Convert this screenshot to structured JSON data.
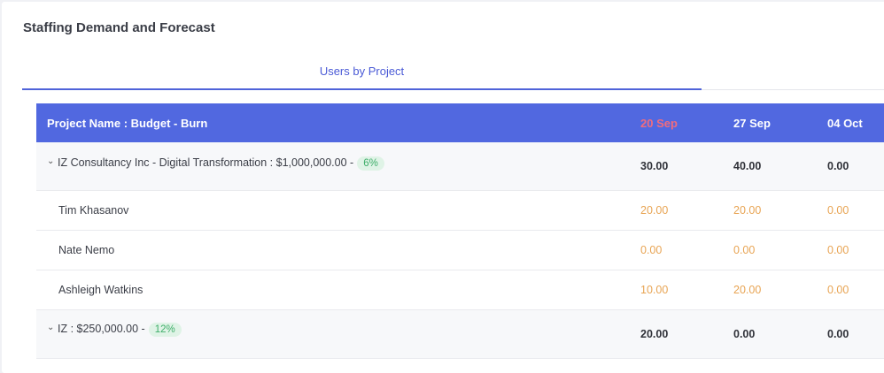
{
  "card": {
    "title": "Staffing Demand and Forecast"
  },
  "tabs": [
    {
      "label": "Users by Project"
    }
  ],
  "table": {
    "header": {
      "name": "Project Name : Budget - Burn",
      "weeks": [
        "20 Sep",
        "27 Sep",
        "04 Oct"
      ],
      "current_week_color": "#f06c7e"
    },
    "groups": [
      {
        "label": "IZ Consultancy Inc - Digital Transformation : $1,000,000.00 -",
        "burn": "6%",
        "totals": [
          "30.00",
          "40.00",
          "0.00"
        ],
        "users": [
          {
            "name": "Tim Khasanov",
            "values": [
              "20.00",
              "20.00",
              "0.00"
            ]
          },
          {
            "name": "Nate Nemo",
            "values": [
              "0.00",
              "0.00",
              "0.00"
            ]
          },
          {
            "name": "Ashleigh Watkins",
            "values": [
              "10.00",
              "20.00",
              "0.00"
            ]
          }
        ]
      },
      {
        "label": "IZ : $250,000.00 -",
        "burn": "12%",
        "totals": [
          "20.00",
          "0.00",
          "0.00"
        ]
      }
    ]
  },
  "colors": {
    "header_bg": "#5168e0",
    "accent": "#4f63d9",
    "user_value": "#e8a453",
    "burn_badge_bg": "#dff3e6",
    "burn_badge_text": "#3fae6a"
  }
}
